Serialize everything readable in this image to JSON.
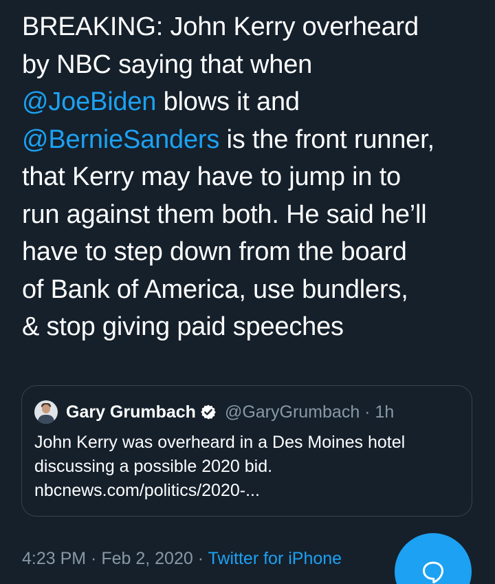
{
  "tweet": {
    "line1": "BREAKING: John Kerry overheard",
    "line2": "by NBC saying that when",
    "mention1": "@JoeBiden",
    "line3_rest": " blows it and",
    "mention2": "@BernieSanders",
    "line4_rest": " is the front runner,",
    "line5": "that Kerry may have to jump in to",
    "line6": "run against them both. He said he’ll",
    "line7": "have to step down from the board",
    "line8": "of Bank of America, use bundlers,",
    "line9": "& stop giving paid speeches"
  },
  "quote": {
    "display_name": "Gary Grumbach",
    "handle_time": "@GaryGrumbach · 1h",
    "body_line1": "John Kerry was overheard in a Des Moines hotel",
    "body_line2": "discussing a possible 2020 bid.",
    "link": "nbcnews.com/politics/2020-..."
  },
  "footer": {
    "timestamp": "4:23 PM · Feb 2, 2020 · ",
    "source": "Twitter for iPhone"
  },
  "colors": {
    "background": "#15202b",
    "accent": "#1da1f2",
    "secondary_text": "#8899a6",
    "border": "#38444d"
  },
  "icons": {
    "verified": "verified-badge-icon",
    "fab": "reply-bubble-icon"
  }
}
